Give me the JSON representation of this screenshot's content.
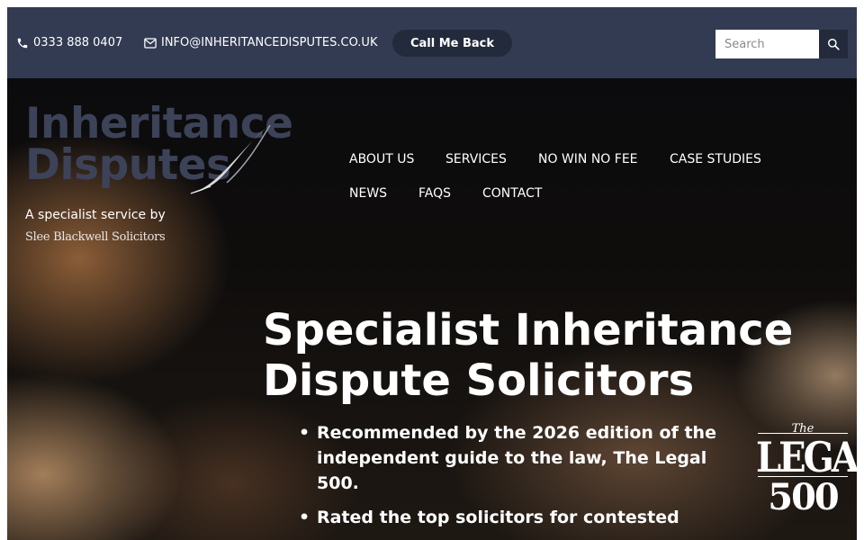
{
  "topbar": {
    "phone": "0333 888 0407",
    "email": "INFO@INHERITANCEDISPUTES.CO.UK",
    "callback_label": "Call Me Back",
    "search_placeholder": "Search",
    "icons": {
      "phone": "phone-icon",
      "email": "envelope-icon",
      "search": "search-icon"
    }
  },
  "brand": {
    "logo_line1": "Inheritance",
    "logo_line2": "Disputes",
    "tagline": "A specialist service by",
    "firm": "Slee Blackwell Solicitors",
    "logo_color": "#3c4258"
  },
  "nav": {
    "items": [
      "ABOUT US",
      "SERVICES",
      "NO WIN NO FEE",
      "CASE STUDIES",
      "NEWS",
      "FAQS",
      "CONTACT"
    ]
  },
  "hero": {
    "headline": "Specialist Inheritance Dispute Solicitors",
    "bullets": [
      "Recommended by the 2026 edition of the independent guide to the law, The Legal 500.",
      "Rated the top solicitors for contested"
    ]
  },
  "badge": {
    "the": "The",
    "legal": "LEGAL",
    "number": "500"
  },
  "colors": {
    "topbar": "#333b52",
    "button": "#232a3c",
    "text": "#ffffff"
  }
}
